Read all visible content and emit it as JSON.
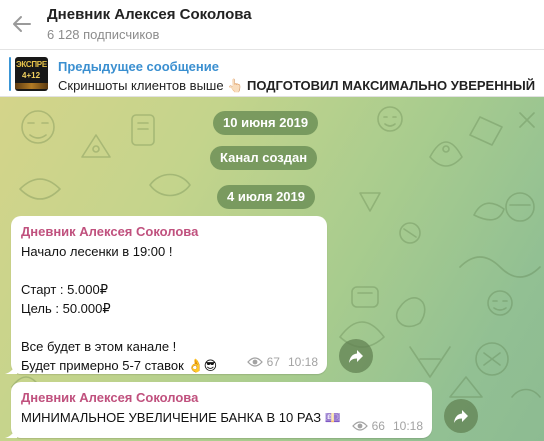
{
  "header": {
    "title": "Дневник Алексея Соколова",
    "subscribers": "6 128 подписчиков"
  },
  "pinned": {
    "thumb_line1": "ЭКСПРЕ",
    "thumb_line2": "4+12",
    "label": "Предыдущее сообщение",
    "text_plain": "Скриншоты клиентов выше 👆🏻",
    "text_bold": "ПОДГОТОВИЛ МАКСИМАЛЬНО УВЕРЕННЫЙ"
  },
  "service": {
    "date1": "10 июня 2019",
    "created": "Канал создан",
    "date2": "4 июля 2019"
  },
  "messages": [
    {
      "author": "Дневник Алексея Соколова",
      "lines": [
        "Начало лесенки в 19:00 !",
        "",
        "Старт : 5.000₽",
        "Цель : 50.000₽",
        "",
        "Все будет в этом канале !",
        "Будет примерно 5-7 ставок 👌😎"
      ],
      "views": "67",
      "time": "10:18"
    },
    {
      "author": "Дневник Алексея Соколова",
      "lines": [
        "МИНИМАЛЬНОЕ УВЕЛИЧЕНИЕ БАНКА В 10 РАЗ 💷"
      ],
      "views": "66",
      "time": "10:18"
    }
  ],
  "icons": {
    "back": "arrow-left-icon",
    "views": "eye-icon",
    "share": "share-arrow-icon"
  },
  "colors": {
    "accent": "#3a8fd0",
    "author": "#c0517e",
    "pill": "#668a52"
  }
}
